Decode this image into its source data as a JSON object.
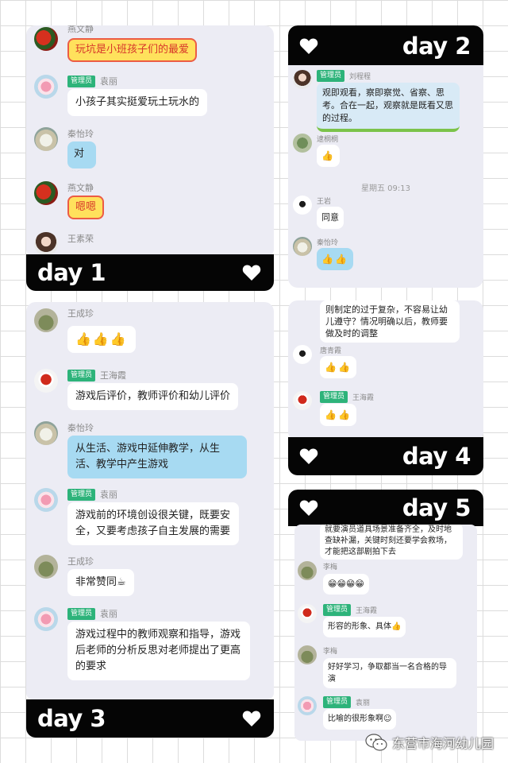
{
  "day1": {
    "label": "day 1",
    "messages": [
      {
        "name": "燕文静",
        "admin": false,
        "text": "玩坑是小班孩子们的最爱"
      },
      {
        "name": "袁丽",
        "admin": true,
        "text": "小孩子其实挺爱玩土玩水的"
      },
      {
        "name": "秦怡玲",
        "admin": false,
        "text": "对"
      },
      {
        "name": "燕文静",
        "admin": false,
        "text": "嗯嗯"
      },
      {
        "name": "王素荣",
        "admin": false,
        "text": ""
      }
    ]
  },
  "day2": {
    "label": "day 2",
    "messages": [
      {
        "name": "刘程程",
        "admin": true,
        "text": "观即观看，察即察觉、省察、思考。合在一起，观察就是既看又思的过程。"
      },
      {
        "name": "逮桐桐",
        "admin": false,
        "text": "👍"
      },
      {
        "name": "王岩",
        "admin": false,
        "text": "同意"
      },
      {
        "name": "秦怡玲",
        "admin": false,
        "text": "👍👍"
      }
    ],
    "time": "星期五 09:13"
  },
  "day3": {
    "label": "day 3",
    "messages": [
      {
        "name": "王成珍",
        "admin": false,
        "text": "👍👍👍"
      },
      {
        "name": "王海霞",
        "admin": true,
        "text": "游戏后评价，教师评价和幼儿评价"
      },
      {
        "name": "秦怡玲",
        "admin": false,
        "text": "从生活、游戏中延伸教学，从生活、教学中产生游戏"
      },
      {
        "name": "袁丽",
        "admin": true,
        "text": "游戏前的环境创设很关键，既要安全，又要考虑孩子自主发展的需要"
      },
      {
        "name": "王成珍",
        "admin": false,
        "text": "非常赞同☕"
      },
      {
        "name": "袁丽",
        "admin": true,
        "text": "游戏过程中的教师观察和指导，游戏后老师的分析反思对老师提出了更高的要求"
      }
    ]
  },
  "day4": {
    "label": "day 4",
    "top_text": "则制定的过于复杂，不容易让幼儿遵守？情况明确以后，教师要做及时的调整",
    "messages": [
      {
        "name": "唐青霞",
        "admin": false,
        "text": "👍👍"
      },
      {
        "name": "王海霞",
        "admin": true,
        "text": "👍👍"
      }
    ]
  },
  "day5": {
    "label": "day 5",
    "top_text": "就要演员道具场景准备齐全，及时地查缺补漏，关键时刻还要学会救场，才能把这部剧拍下去",
    "messages": [
      {
        "name": "李梅",
        "admin": false,
        "text": "😁😁😁😁"
      },
      {
        "name": "王海霞",
        "admin": true,
        "text": "形容的形象、具体👍"
      },
      {
        "name": "李梅",
        "admin": false,
        "text": "好好学习，争取都当一名合格的导演"
      },
      {
        "name": "袁丽",
        "admin": true,
        "text": "比喻的很形象啊☺"
      }
    ]
  },
  "admin_label": "管理员",
  "footer": {
    "org": "东营市海河幼儿园"
  },
  "colors": {
    "bar": "#050505",
    "chat_bg": "#ececf4",
    "admin_badge": "#2db37a",
    "grid": "#dcdcdc"
  }
}
